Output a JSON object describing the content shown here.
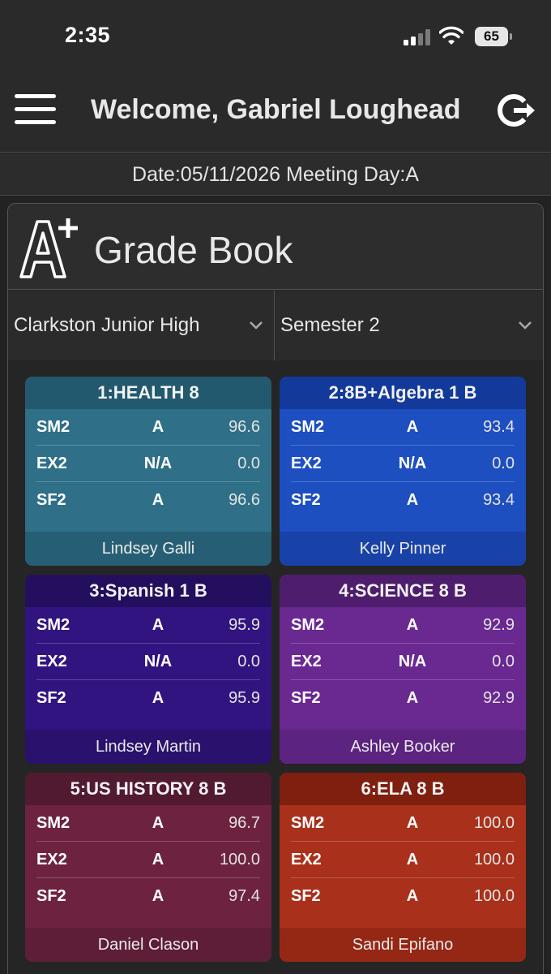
{
  "status_bar": {
    "time": "2:35",
    "battery": "65"
  },
  "header": {
    "welcome": "Welcome, Gabriel Loughead"
  },
  "date_bar": {
    "text": "Date:05/11/2026 Meeting Day:A"
  },
  "gradebook": {
    "title": "Grade Book",
    "school_select": "Clarkston Junior High",
    "term_select": "Semester 2"
  },
  "cards": [
    {
      "title": "1:HEALTH 8",
      "teacher": "Lindsey Galli",
      "rows": [
        {
          "label": "SM2",
          "letter": "A",
          "score": "96.6"
        },
        {
          "label": "EX2",
          "letter": "N/A",
          "score": "0.0"
        },
        {
          "label": "SF2",
          "letter": "A",
          "score": "96.6"
        }
      ],
      "colors": {
        "title_bg": "#23596e",
        "body_bg": "#2f7088",
        "footer_bg": "#265f75"
      }
    },
    {
      "title": "2:8B+Algebra 1 B",
      "teacher": "Kelly Pinner",
      "rows": [
        {
          "label": "SM2",
          "letter": "A",
          "score": "93.4"
        },
        {
          "label": "EX2",
          "letter": "N/A",
          "score": "0.0"
        },
        {
          "label": "SF2",
          "letter": "A",
          "score": "93.4"
        }
      ],
      "colors": {
        "title_bg": "#133a9a",
        "body_bg": "#1d4fc0",
        "footer_bg": "#1842a8"
      }
    },
    {
      "title": "3:Spanish 1 B",
      "teacher": "Lindsey Martin",
      "rows": [
        {
          "label": "SM2",
          "letter": "A",
          "score": "95.9"
        },
        {
          "label": "EX2",
          "letter": "N/A",
          "score": "0.0"
        },
        {
          "label": "SF2",
          "letter": "A",
          "score": "95.9"
        }
      ],
      "colors": {
        "title_bg": "#230f5e",
        "body_bg": "#311480",
        "footer_bg": "#2a116d"
      }
    },
    {
      "title": "4:SCIENCE 8 B",
      "teacher": "Ashley Booker",
      "rows": [
        {
          "label": "SM2",
          "letter": "A",
          "score": "92.9"
        },
        {
          "label": "EX2",
          "letter": "N/A",
          "score": "0.0"
        },
        {
          "label": "SF2",
          "letter": "A",
          "score": "92.9"
        }
      ],
      "colors": {
        "title_bg": "#4f1d6d",
        "body_bg": "#6a2891",
        "footer_bg": "#5c2380"
      }
    },
    {
      "title": "5:US HISTORY 8 B",
      "teacher": "Daniel Clason",
      "rows": [
        {
          "label": "SM2",
          "letter": "A",
          "score": "96.7"
        },
        {
          "label": "EX2",
          "letter": "A",
          "score": "100.0"
        },
        {
          "label": "SF2",
          "letter": "A",
          "score": "97.4"
        }
      ],
      "colors": {
        "title_bg": "#521a30",
        "body_bg": "#6d2340",
        "footer_bg": "#5e1e37"
      }
    },
    {
      "title": "6:ELA 8 B",
      "teacher": "Sandi Epifano",
      "rows": [
        {
          "label": "SM2",
          "letter": "A",
          "score": "100.0"
        },
        {
          "label": "EX2",
          "letter": "A",
          "score": "100.0"
        },
        {
          "label": "SF2",
          "letter": "A",
          "score": "100.0"
        }
      ],
      "colors": {
        "title_bg": "#7e1f0f",
        "body_bg": "#a9301a",
        "footer_bg": "#952815"
      }
    }
  ]
}
